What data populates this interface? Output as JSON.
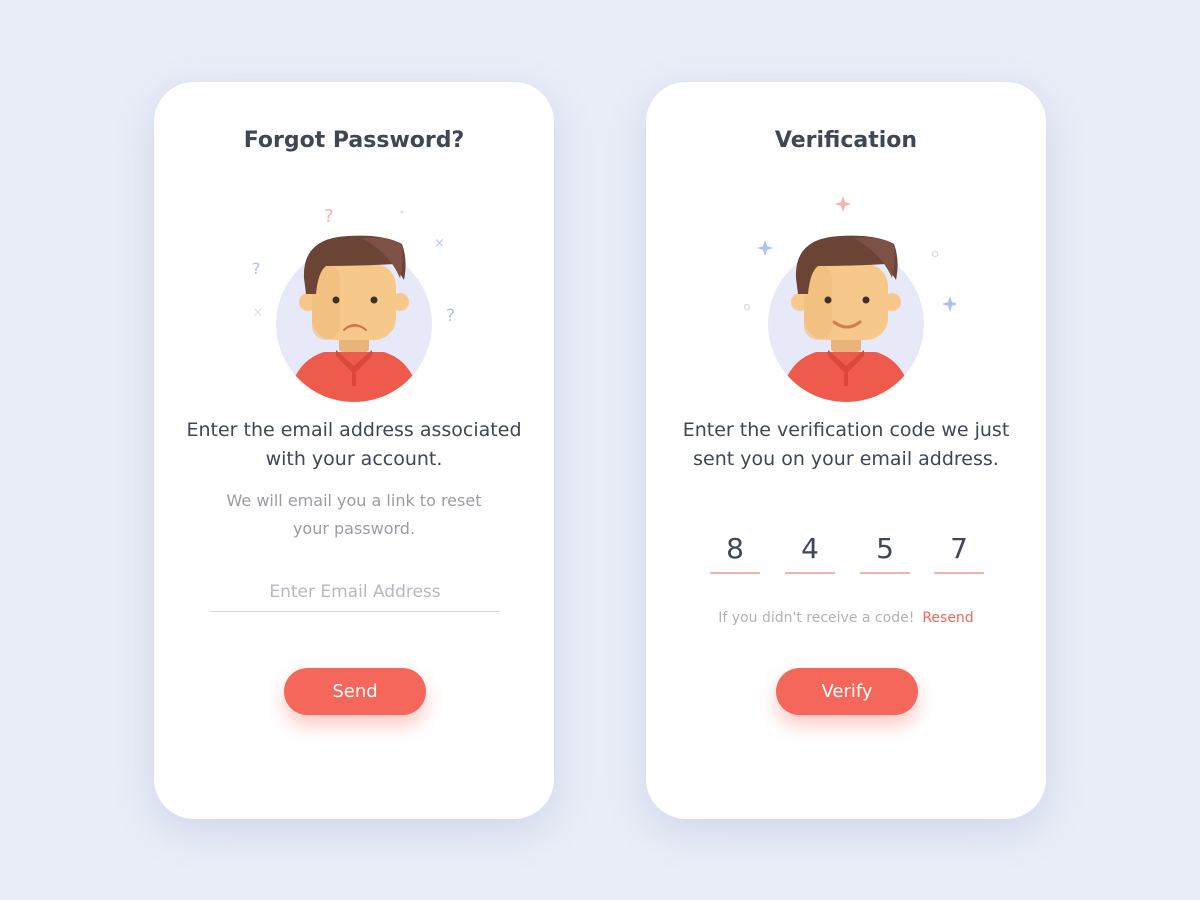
{
  "forgot": {
    "title": "Forgot Password?",
    "heading": "Enter the email address associated with your account.",
    "subtext": "We will email you a link to reset your password.",
    "email_placeholder": "Enter Email Address",
    "email_value": "",
    "send_label": "Send",
    "avatar_expression": "sad",
    "decorations": [
      "?",
      "?",
      "?",
      "×",
      "×"
    ]
  },
  "verify": {
    "title": "Verification",
    "heading": "Enter the verification code we just sent you on your email address.",
    "code": [
      "8",
      "4",
      "5",
      "7"
    ],
    "resend_prompt": "If you didn't receive a code!",
    "resend_label": "Resend",
    "verify_label": "Verify",
    "avatar_expression": "smile"
  },
  "colors": {
    "background": "#e9edf7",
    "card": "#ffffff",
    "accent": "#f4675a",
    "text_dark": "#3f4654",
    "text_muted": "#9a9ca4",
    "avatar_circle": "#e8e9f8",
    "hair": "#6b4436",
    "skin": "#f6c98a",
    "shirt": "#ee5a4c"
  }
}
